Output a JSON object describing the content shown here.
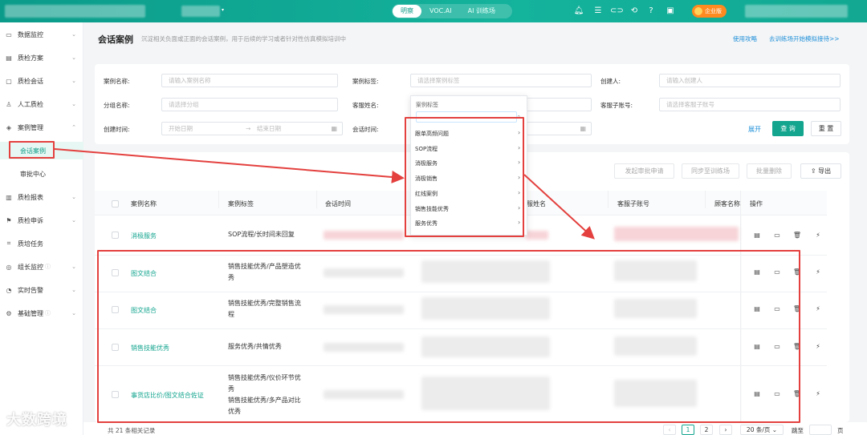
{
  "header": {
    "tabs": [
      {
        "label": "明察",
        "active": true
      },
      {
        "label": "VOC.AI",
        "active": false
      },
      {
        "label": "AI 训练场",
        "active": false
      }
    ],
    "badge_label": "企业版",
    "icons": [
      "bell-icon",
      "list-icon",
      "link-icon",
      "headset-icon",
      "help-icon",
      "doc-icon"
    ]
  },
  "sidebar": {
    "items": [
      {
        "label": "数据监控",
        "icon": "monitor-icon"
      },
      {
        "label": "质检方案",
        "icon": "plan-icon"
      },
      {
        "label": "质检会话",
        "icon": "chat-icon"
      },
      {
        "label": "人工质检",
        "icon": "user-icon"
      },
      {
        "label": "案例管理",
        "icon": "case-icon",
        "expanded": true
      },
      {
        "label": "会话案例",
        "sub": true,
        "active": true
      },
      {
        "label": "审批中心",
        "sub": true
      },
      {
        "label": "质检报表",
        "icon": "report-icon"
      },
      {
        "label": "质检申诉",
        "icon": "appeal-icon"
      },
      {
        "label": "质培任务",
        "icon": "task-icon"
      },
      {
        "label": "组长监控",
        "icon": "leader-icon"
      },
      {
        "label": "实时告警",
        "icon": "alarm-icon"
      },
      {
        "label": "基础管理",
        "icon": "settings-icon"
      }
    ]
  },
  "page": {
    "title": "会话案例",
    "description": "沉淀相关负面或正面的会话案例，用于后续的学习或者针对性仿真模拟培训中",
    "links": [
      "使用攻略",
      "去训练场开始模拟接待>>"
    ]
  },
  "filters": {
    "case_name_label": "案例名称:",
    "case_name_placeholder": "请输入案例名称",
    "case_tag_label": "案例标签:",
    "case_tag_placeholder": "请选择案例标签",
    "creator_label": "创建人:",
    "creator_placeholder": "请输入创建人",
    "group_label": "分组名称:",
    "group_placeholder": "请选择分组",
    "agent_label": "客服姓名:",
    "sub_account_label": "客服子账号:",
    "sub_account_placeholder": "请选择客服子账号",
    "created_time_label": "创建时间:",
    "start_placeholder": "开始日期",
    "end_placeholder": "结束日期",
    "session_time_label": "会话时间:",
    "expand": "展开",
    "query": "查 询",
    "reset": "重 置"
  },
  "toolbar": {
    "submit_approval": "发起审批申请",
    "sync_training": "同步至训练场",
    "batch_delete": "批量删除",
    "export": "导出"
  },
  "table": {
    "headers": [
      "案例名称",
      "案例标签",
      "会话时间",
      "服姓名",
      "客服子账号",
      "顾客名称",
      "操作"
    ],
    "rows": [
      {
        "name": "消极服务",
        "tags": [
          "SOP流程/长时间未回复"
        ]
      },
      {
        "name": "图文结合",
        "tags": [
          "销售技能优秀/产品塑造优",
          "秀"
        ]
      },
      {
        "name": "图文结合",
        "tags": [
          "销售技能优秀/完整销售流",
          "程"
        ]
      },
      {
        "name": "销售技能优秀",
        "tags": [
          "服务优秀/共情优秀"
        ]
      },
      {
        "name": "事货店比价/图文结合佐证",
        "tags": [
          "销售技能优秀/仪价环节优",
          "秀",
          "销售技能优秀/多产品对比",
          "优秀"
        ]
      }
    ]
  },
  "dropdown": {
    "title": "案例标签",
    "items": [
      "跟单高频问题",
      "SOP流程",
      "消极服务",
      "消极销售",
      "红线案例",
      "销售技能优秀",
      "服务优秀"
    ]
  },
  "footer": {
    "total": "共 21 条相关记录",
    "pages": [
      "1",
      "2"
    ],
    "page_size": "20 条/页",
    "jump_label": "跳至",
    "page_suffix": "页"
  },
  "watermark": "大数跨境"
}
